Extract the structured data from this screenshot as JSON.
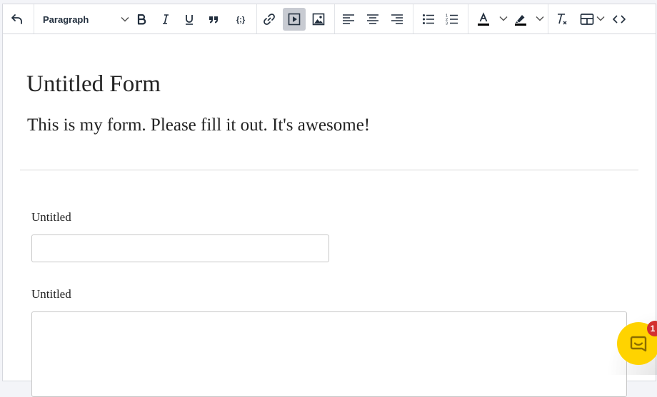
{
  "toolbar": {
    "block_format": "Paragraph"
  },
  "form": {
    "title": "Untitled Form",
    "description": "This is my form. Please fill it out. It's awesome!",
    "fields": [
      {
        "label": "Untitled",
        "type": "text"
      },
      {
        "label": "Untitled",
        "type": "textarea"
      }
    ]
  },
  "chat": {
    "badge_count": "1"
  },
  "colors": {
    "accent_yellow": "#ffd300",
    "badge_red": "#d32f2f",
    "toolbar_active": "#c8cbd2",
    "icon": "#222f3e"
  }
}
